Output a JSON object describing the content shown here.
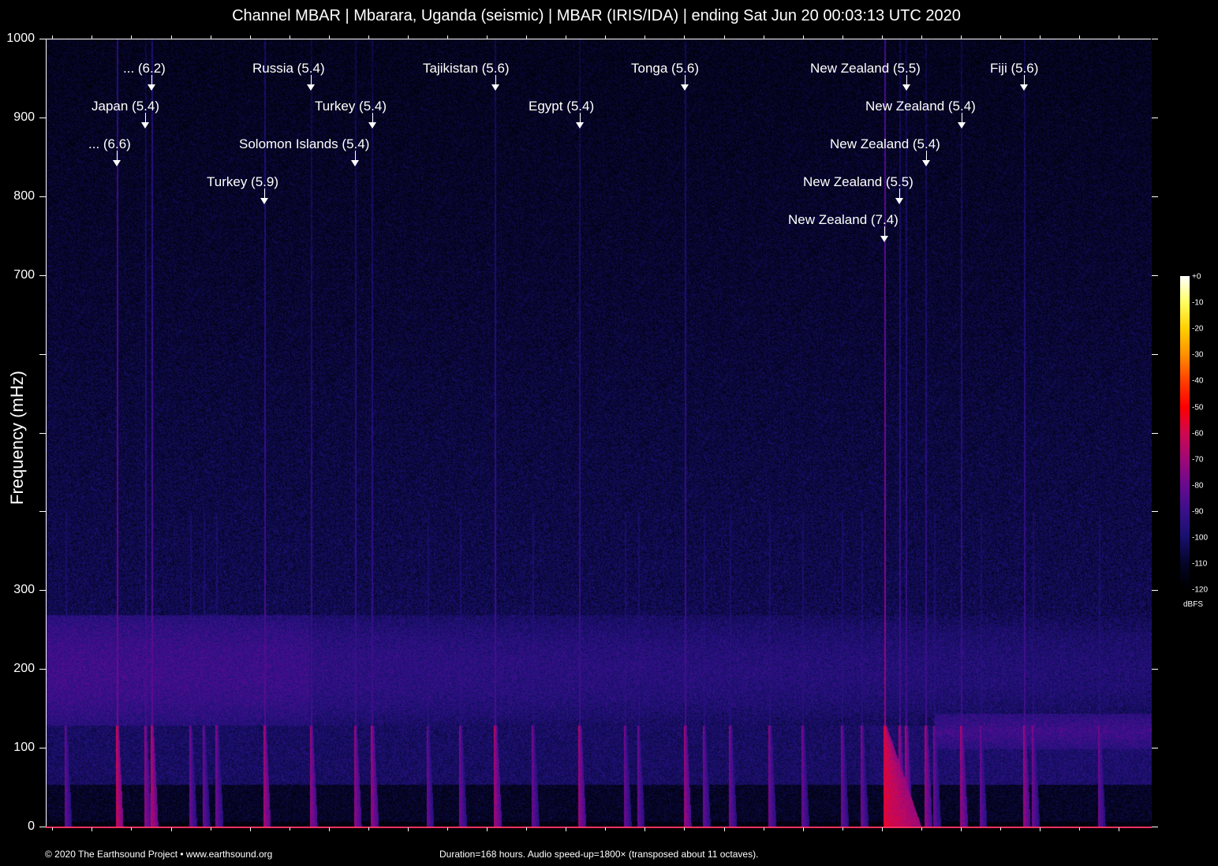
{
  "title": "Channel MBAR | Mbarara, Uganda (seismic) | MBAR (IRIS/IDA) | ending Sat Jun 20 00:03:13 UTC 2020",
  "footer": {
    "copyright": "© 2020 The Earthsound Project • www.earthsound.org",
    "info": "Duration=168 hours. Audio speed-up=1800× (transposed about 11 octaves)."
  },
  "chart_data": {
    "type": "heatmap",
    "title": "Channel MBAR | Mbarara, Uganda (seismic) | MBAR (IRIS/IDA) | ending Sat Jun 20 00:03:13 UTC 2020",
    "xlabel": "",
    "ylabel": "Frequency (mHz)",
    "xlim": [
      0,
      168
    ],
    "x_units": "hours",
    "ylim": [
      0,
      1000
    ],
    "y_ticks": [
      0,
      100,
      200,
      300,
      400,
      500,
      600,
      700,
      800,
      900,
      1000
    ],
    "y_tick_labels": [
      "0",
      "100",
      "200",
      "300",
      "",
      "",
      "",
      "700",
      "800",
      "900",
      "1000"
    ],
    "x_tick_interval_hours": 6,
    "colorbar": {
      "unit": "dBFS",
      "range": [
        -120,
        0
      ],
      "tick_labels": [
        "+0",
        "-10",
        "-20",
        "-30",
        "-40",
        "-50",
        "-60",
        "-70",
        "-80",
        "-90",
        "-100",
        "-110",
        "-120"
      ]
    },
    "events": [
      {
        "label": "... (6.2)",
        "hours": 16.1
      },
      {
        "label": "Japan (5.4)",
        "hours": 15.1
      },
      {
        "label": "... (6.6)",
        "hours": 10.8
      },
      {
        "label": "Russia (5.4)",
        "hours": 40.3
      },
      {
        "label": "Turkey (5.4)",
        "hours": 49.6
      },
      {
        "label": "Solomon Islands (5.4)",
        "hours": 47.0
      },
      {
        "label": "Turkey (5.9)",
        "hours": 33.2
      },
      {
        "label": "Tajikistan (5.6)",
        "hours": 68.3
      },
      {
        "label": "Egypt (5.4)",
        "hours": 81.1
      },
      {
        "label": "Tonga (5.6)",
        "hours": 97.1
      },
      {
        "label": "New Zealand (5.5)",
        "hours": 130.7
      },
      {
        "label": "New Zealand (5.4)",
        "hours": 139.1
      },
      {
        "label": "New Zealand (5.4)",
        "hours": 133.7
      },
      {
        "label": "New Zealand (5.5)",
        "hours": 129.7
      },
      {
        "label": "New Zealand (7.4)",
        "hours": 127.4
      },
      {
        "label": "Fiji (5.6)",
        "hours": 148.6
      }
    ]
  }
}
